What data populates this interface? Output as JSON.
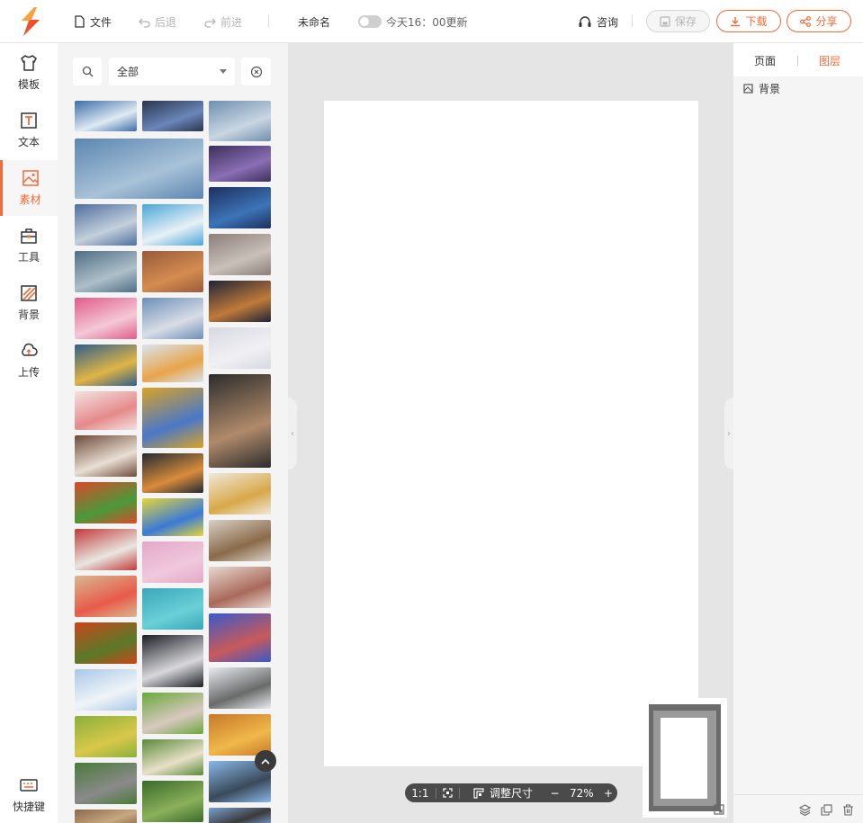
{
  "topbar": {
    "file_label": "文件",
    "undo_label": "后退",
    "redo_label": "前进",
    "doc_name": "未命名",
    "autosave_text": "今天16：00更新",
    "consult_label": "咨询",
    "save_label": "保存",
    "download_label": "下载",
    "share_label": "分享"
  },
  "colors": {
    "accent": "#f26b3a",
    "logo_orange": "#f7a23b",
    "logo_red": "#f04e2f"
  },
  "leftnav": {
    "items": [
      {
        "label": "模板",
        "icon": "tshirt-icon"
      },
      {
        "label": "文本",
        "icon": "text-icon"
      },
      {
        "label": "素材",
        "icon": "image-icon",
        "active": true
      },
      {
        "label": "工具",
        "icon": "toolbox-icon"
      },
      {
        "label": "背景",
        "icon": "background-icon"
      },
      {
        "label": "上传",
        "icon": "cloud-upload-icon"
      }
    ],
    "shortcut_label": "快捷键"
  },
  "materials": {
    "category": "全部"
  },
  "zoom": {
    "ratio_label": "1:1",
    "resize_label": "调整尺寸",
    "minus": "−",
    "value": "72%",
    "plus": "+"
  },
  "rightpanel": {
    "tab_page": "页面",
    "tab_layers": "图层",
    "layer_name": "背景"
  }
}
